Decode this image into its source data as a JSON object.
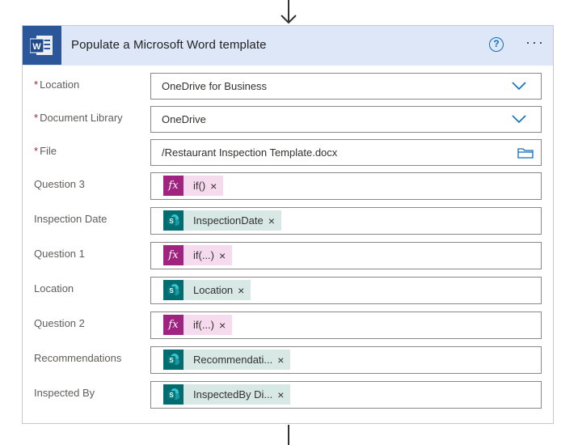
{
  "action": {
    "title": "Populate a Microsoft Word template",
    "help_label": "?",
    "more_label": "···"
  },
  "fields": {
    "location": {
      "label": "Location",
      "required_mark": "*",
      "value": "OneDrive for Business"
    },
    "document_library": {
      "label": "Document Library",
      "required_mark": "*",
      "value": "OneDrive"
    },
    "file": {
      "label": "File",
      "required_mark": "*",
      "value": "/Restaurant Inspection Template.docx"
    }
  },
  "dynamic_fields": [
    {
      "label": "Question 3",
      "token_type": "expression",
      "token_icon": "fx-icon",
      "token_text": "if()"
    },
    {
      "label": "Inspection Date",
      "token_type": "sharepoint",
      "token_icon": "sharepoint-icon",
      "token_text": "InspectionDate"
    },
    {
      "label": "Question 1",
      "token_type": "expression",
      "token_icon": "fx-icon",
      "token_text": "if(...)"
    },
    {
      "label": "Location",
      "token_type": "sharepoint",
      "token_icon": "sharepoint-icon",
      "token_text": "Location"
    },
    {
      "label": "Question 2",
      "token_type": "expression",
      "token_icon": "fx-icon",
      "token_text": "if(...)"
    },
    {
      "label": "Recommendations",
      "token_type": "sharepoint",
      "token_icon": "sharepoint-icon",
      "token_text": "Recommendati..."
    },
    {
      "label": "Inspected By",
      "token_type": "sharepoint",
      "token_icon": "sharepoint-icon",
      "token_text": "InspectedBy Di..."
    }
  ],
  "token_remove_label": "×",
  "fx_glyph": "fx",
  "colors": {
    "header_bg": "#dde7f7",
    "word_blue": "#2b579a",
    "fx_token_bg": "#f6dbef",
    "fx_icon_bg": "#a0237f",
    "sp_token_bg": "#d7e8e5",
    "sp_icon_bg": "#036c70",
    "required": "#a4262c",
    "accent": "#0f6cbd"
  }
}
